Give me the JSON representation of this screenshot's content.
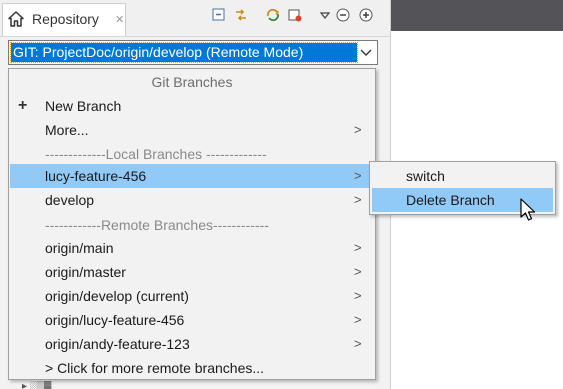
{
  "tab": {
    "label": "Repository",
    "close": "✕"
  },
  "combo": {
    "value": "GIT: ProjectDoc/origin/develop   (Remote Mode)"
  },
  "menu": {
    "header": "Git Branches",
    "new_branch": "New Branch",
    "more": "More...",
    "local_sep": "-------------Local   Branches -------------",
    "local_branches": [
      "lucy-feature-456",
      "develop"
    ],
    "remote_sep": "------------Remote Branches------------",
    "remote_branches": [
      "origin/main",
      "origin/master",
      "origin/develop (current)",
      "origin/lucy-feature-456",
      "origin/andy-feature-123"
    ],
    "more_remote": "> Click for more remote branches...",
    "arrow": ">",
    "plus": "+"
  },
  "submenu": {
    "switch": "switch",
    "delete": "Delete Branch"
  },
  "colors": {
    "selection": "#91c9f7",
    "combo_selected": "#0078d7",
    "dark_header": "#535358"
  }
}
